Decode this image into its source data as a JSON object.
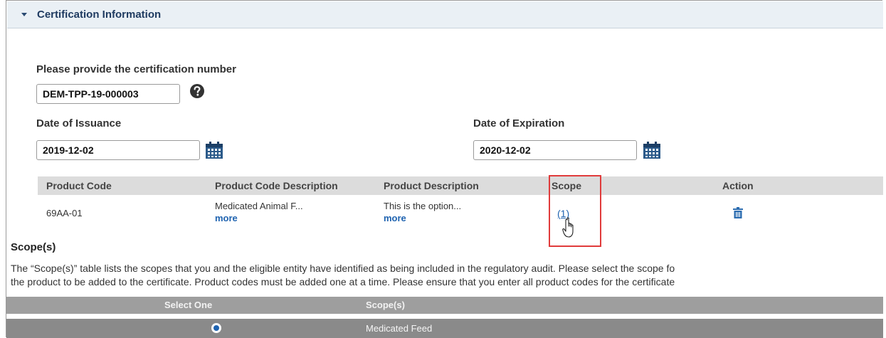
{
  "section": {
    "title": "Certification Information"
  },
  "cert_number": {
    "label": "Please provide the certification number",
    "value": "DEM-TPP-19-000003",
    "help_icon": "question-circle-icon"
  },
  "issuance": {
    "label": "Date of Issuance",
    "value": "2019-12-02",
    "icon": "calendar-icon"
  },
  "expiration": {
    "label": "Date of Expiration",
    "value": "2020-12-02",
    "icon": "calendar-icon"
  },
  "products_table": {
    "headers": [
      "Product Code",
      "Product Code Description",
      "Product Description",
      "Scope",
      "Action"
    ],
    "rows": [
      {
        "product_code": "69AA-01",
        "code_description": "Medicated Animal F...",
        "code_description_more": "more",
        "product_description": "This is the option...",
        "product_description_more": "more",
        "scope": "(1)",
        "action_icon": "trash-icon"
      }
    ]
  },
  "scopes": {
    "title": "Scope(s)",
    "description_line1": "The “Scope(s)” table lists the scopes that you and the eligible entity have identified as being included in the regulatory audit. Please select the scope fo",
    "description_line2": "the product to be added to the certificate. Product codes must be added one at a time. Please ensure that you enter all product codes for the certificate",
    "table": {
      "headers": [
        "Select One",
        "Scope(s)"
      ],
      "rows": [
        {
          "selected": true,
          "scope": "Medicated Feed"
        }
      ]
    }
  },
  "colors": {
    "link": "#1f63b0",
    "highlight": "#e03b3b",
    "header_bg": "#eaf0f5"
  }
}
